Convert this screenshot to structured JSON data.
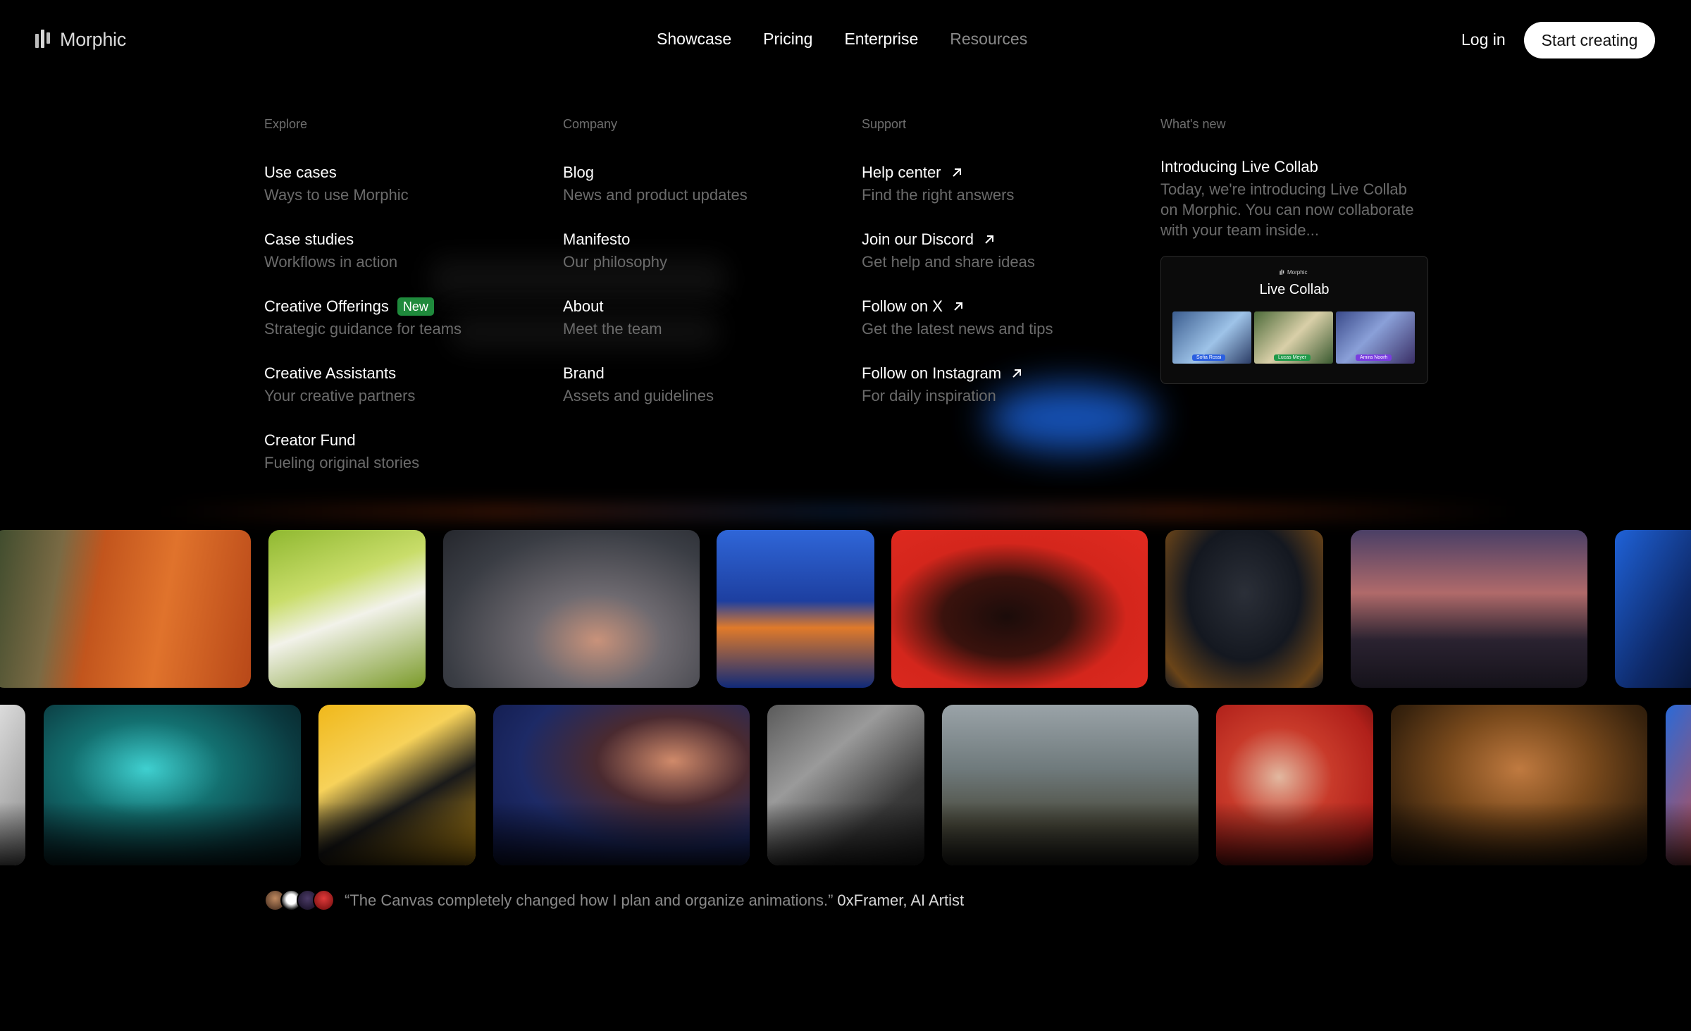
{
  "brand": {
    "name": "Morphic"
  },
  "nav": {
    "links": [
      {
        "label": "Showcase",
        "active": false
      },
      {
        "label": "Pricing",
        "active": false
      },
      {
        "label": "Enterprise",
        "active": false
      },
      {
        "label": "Resources",
        "active": true
      }
    ],
    "login": "Log in",
    "cta": "Start creating"
  },
  "menu": {
    "explore": {
      "title": "Explore",
      "items": [
        {
          "title": "Use cases",
          "sub": "Ways to use Morphic"
        },
        {
          "title": "Case studies",
          "sub": "Workflows in action"
        },
        {
          "title": "Creative Offerings",
          "sub": "Strategic guidance for teams",
          "badge": "New"
        },
        {
          "title": "Creative Assistants",
          "sub": "Your creative partners"
        },
        {
          "title": "Creator Fund",
          "sub": "Fueling original stories"
        }
      ]
    },
    "company": {
      "title": "Company",
      "items": [
        {
          "title": "Blog",
          "sub": "News and product updates"
        },
        {
          "title": "Manifesto",
          "sub": "Our philosophy"
        },
        {
          "title": "About",
          "sub": "Meet the team"
        },
        {
          "title": "Brand",
          "sub": "Assets and guidelines"
        }
      ]
    },
    "support": {
      "title": "Support",
      "items": [
        {
          "title": "Help center",
          "sub": "Find the right answers",
          "icon": "external-arrow-icon"
        },
        {
          "title": "Join our Discord",
          "sub": "Get help and share ideas",
          "icon": "external-arrow-icon"
        },
        {
          "title": "Follow on X",
          "sub": "Get the latest news and tips",
          "icon": "external-arrow-icon"
        },
        {
          "title": "Follow on Instagram",
          "sub": "For daily inspiration",
          "icon": "external-arrow-icon"
        }
      ]
    },
    "whats_new": {
      "title": "What's new",
      "headline": "Introducing Live Collab",
      "body": "Today, we're introducing Live Collab on Morphic. You can now collaborate with your team inside...",
      "card": {
        "logo": "Morphic",
        "title": "Live Collab",
        "people": [
          {
            "name": "Sofia Rossi",
            "color": "#2b5fe0"
          },
          {
            "name": "Lucas Meyer",
            "color": "#1f9a4a"
          },
          {
            "name": "Amira Noorh",
            "color": "#7a3ce0"
          }
        ]
      }
    }
  },
  "testimonial": {
    "quote": "“The Canvas completely changed how I plan and organize animations.”",
    "author": "0xFramer, AI Artist"
  }
}
